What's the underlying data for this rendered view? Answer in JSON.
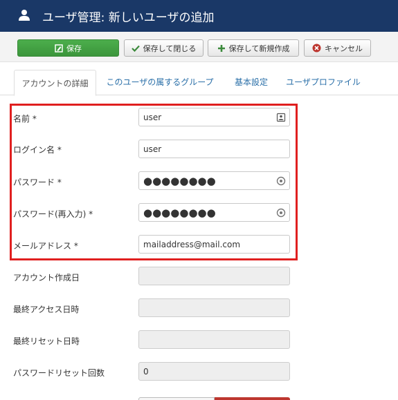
{
  "header": {
    "title": "ユーザ管理: 新しいユーザの追加",
    "icon": "user-icon"
  },
  "toolbar": {
    "save_label": "保存",
    "save_close_label": "保存して閉じる",
    "save_new_label": "保存して新規作成",
    "cancel_label": "キャンセル"
  },
  "tabs": [
    {
      "label": "アカウントの詳細",
      "active": true
    },
    {
      "label": "このユーザの属するグループ",
      "active": false
    },
    {
      "label": "基本設定",
      "active": false
    },
    {
      "label": "ユーザプロファイル",
      "active": false
    }
  ],
  "form": {
    "name": {
      "label": "名前 *",
      "value": "user"
    },
    "login": {
      "label": "ログイン名 *",
      "value": "user"
    },
    "password": {
      "label": "パスワード *",
      "value": "●●●●●●●●"
    },
    "password2": {
      "label": "パスワード(再入力) *",
      "value": "●●●●●●●●"
    },
    "email": {
      "label": "メールアドレス *",
      "value": "mailaddress@mail.com"
    },
    "created": {
      "label": "アカウント作成日",
      "value": ""
    },
    "last_access": {
      "label": "最終アクセス日時",
      "value": ""
    },
    "last_reset": {
      "label": "最終リセット日時",
      "value": ""
    },
    "reset_count": {
      "label": "パスワードリセット回数",
      "value": "0"
    }
  },
  "colors": {
    "header_bg": "#1a3867",
    "save_green": "#46a546",
    "highlight_red": "#e01f1f",
    "tab_link": "#2a6fa8"
  }
}
